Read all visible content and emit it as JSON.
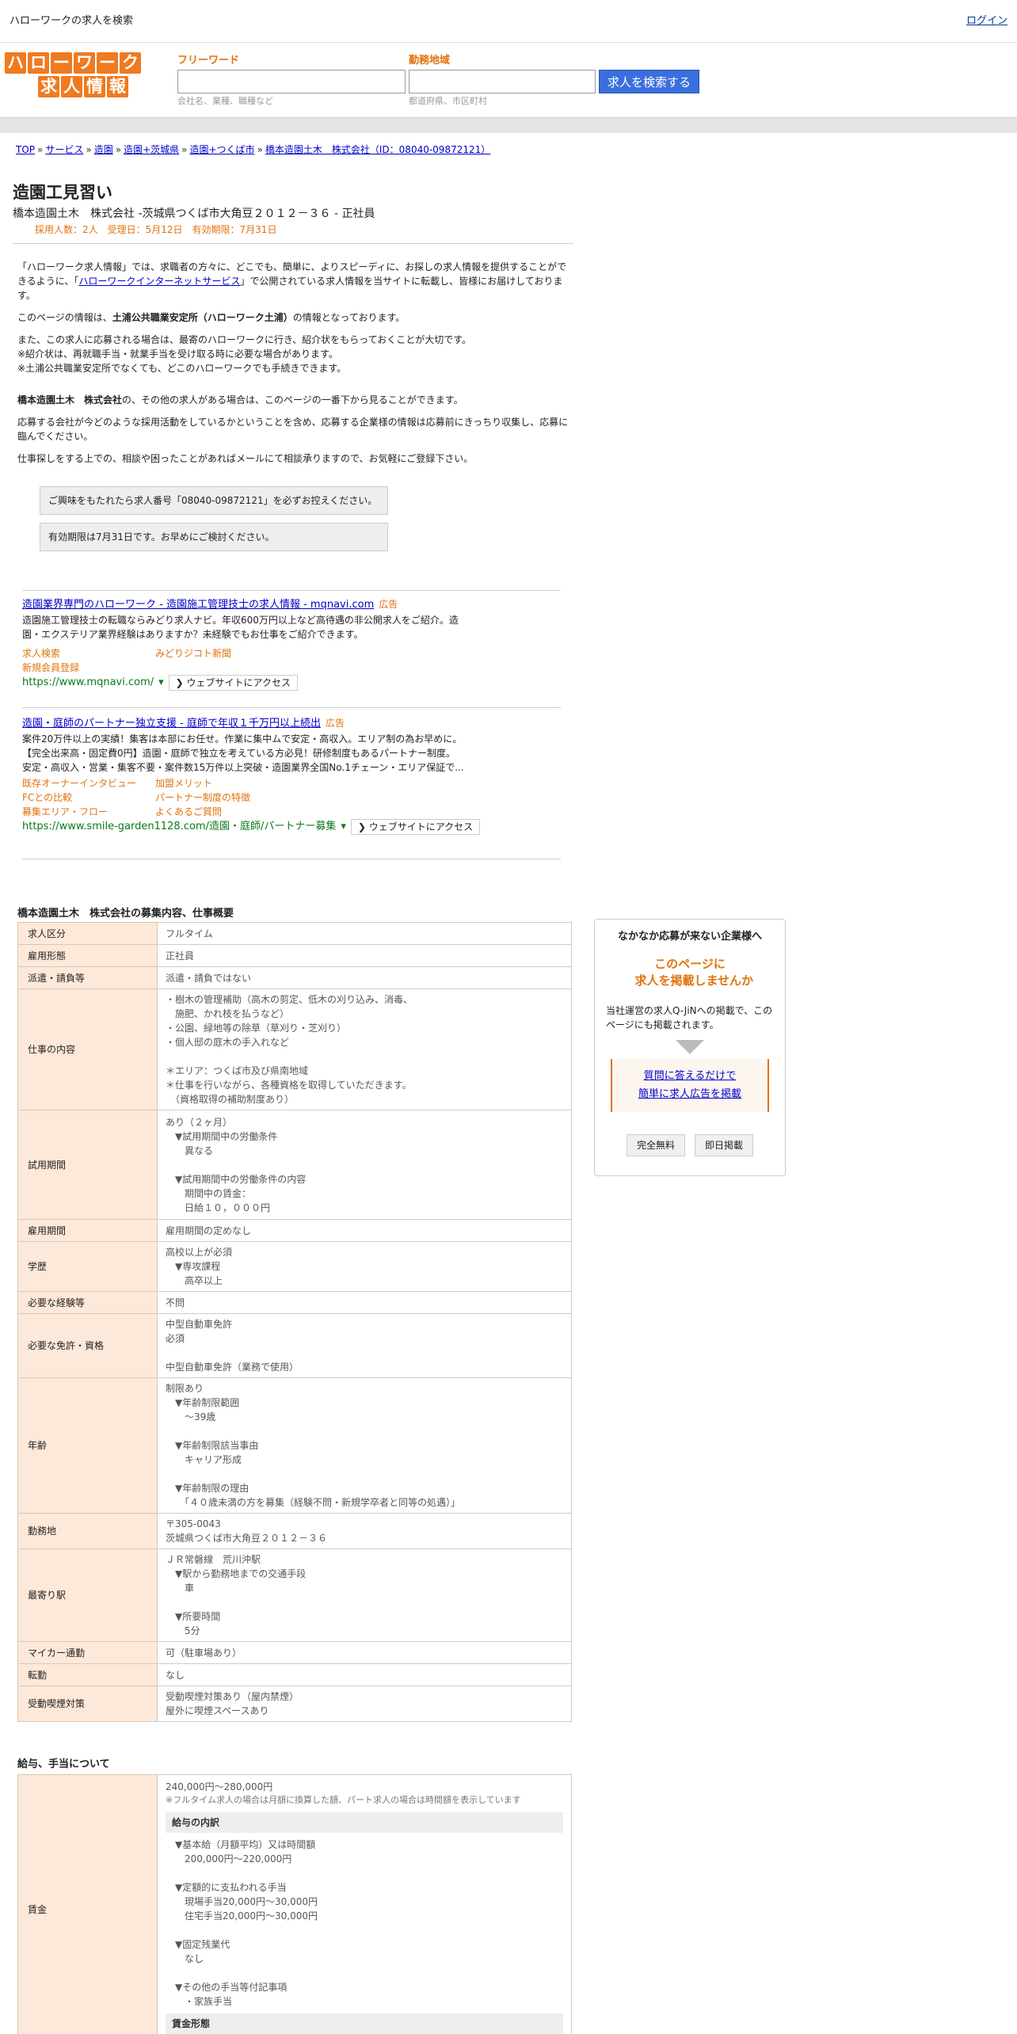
{
  "topbar": {
    "title": "ハローワークの求人を検索",
    "login": "ログイン"
  },
  "logo": {
    "row1": [
      "ハ",
      "ロ",
      "ー",
      "ワ",
      "ー",
      "ク"
    ],
    "row2": [
      "求",
      "人",
      "情",
      "報"
    ]
  },
  "search": {
    "keyword_label": "フリーワード",
    "keyword_placeholder": "会社名、業種、職種など",
    "area_label": "勤務地域",
    "area_placeholder": "都道府県、市区町村",
    "button": "求人を検索する"
  },
  "breadcrumb": [
    "TOP",
    "サービス",
    "造園",
    "造園+茨城県",
    "造園+つくば市",
    "橋本造園土木　株式会社（ID：08040-09872121）"
  ],
  "job": {
    "title": "造園工見習い",
    "subtitle": "橋本造園土木　株式会社 -茨城県つくば市大角豆２０１２－３６ - 正社員",
    "meta": "採用人数：2人　受理日：5月12日　有効期限：7月31日"
  },
  "intro": {
    "p1a": "「ハローワーク求人情報」では、求職者の方々に、どこでも、簡単に、よりスピーディに、お探しの求人情報を提供することができるように、「",
    "p1link": "ハローワークインターネットサービス",
    "p1b": "」で公開されている求人情報を当サイトに転載し、皆様にお届けしております。",
    "p2a": "このページの情報は、",
    "p2b": "土浦公共職業安定所（ハローワーク土浦）",
    "p2c": "の情報となっております。",
    "p3": "また、この求人に応募される場合は、最寄のハローワークに行き、紹介状をもらっておくことが大切です。",
    "p3b": "※紹介状は、再就職手当・就業手当を受け取る時に必要な場合があります。",
    "p3c": "※土浦公共職業安定所でなくても、どこのハローワークでも手続きできます。",
    "p4a": "橋本造園土木　株式会社",
    "p4b": "の、その他の求人がある場合は、このページの一番下から見ることができます。",
    "p5": "応募する会社が今どのような採用活動をしているかということを含め、応募する企業様の情報は応募前にきっちり収集し、応募に臨んでください。",
    "p6": "仕事探しをする上での、相談や困ったことがあればメールにて相談承りますので、お気軽にご登録下さい。",
    "note1": "ご興味をもたれたら求人番号「08040-09872121」を必ずお控えください。",
    "note2": "有効期限は7月31日です。お早めにご検討ください。"
  },
  "ad1": {
    "title": "造園業界専門のハローワーク - 造園施工管理技士の求人情報 - mqnavi.com",
    "tag": "広告",
    "desc1": "造園施工管理技士の転職ならみどり求人ナビ。年収600万円以上など高待遇の非公開求人をご紹介。造",
    "desc2": "園・エクステリア業界経験はありますか？未経験でもお仕事をご紹介できます。",
    "links": [
      "求人検索",
      "みどりジコト新聞",
      "新規会員登録"
    ],
    "url": "https://www.mqnavi.com/",
    "visit": "ウェブサイトにアクセス"
  },
  "ad2": {
    "title": "造園・庭師のパートナー独立支援 - 庭師で年収１千万円以上続出",
    "tag": "広告",
    "desc1": "案件20万件以上の実績！集客は本部にお任せ。作業に集中ムで安定・高収入。エリア制の為お早めに。",
    "desc2": "【完全出来高・固定費0円】造園・庭師で独立を考えている方必見！研修制度もあるパートナー制度。",
    "desc3": "安定・高収入・営業・集客不要・案件数15万件以上突破・造園業界全国No.1チェーン・エリア保証で...",
    "links": [
      "既存オーナーインタビュー",
      "加盟メリット",
      "FCとの比較",
      "パートナー制度の特徴",
      "募集エリア・フロー",
      "よくあるご質問"
    ],
    "url": "https://www.smile-garden1128.com/造園・庭師/パートナー募集",
    "visit": "ウェブサイトにアクセス"
  },
  "spec_title": "橋本造園土木　株式会社の募集内容、仕事概要",
  "spec": [
    {
      "k": "求人区分",
      "v": "フルタイム"
    },
    {
      "k": "雇用形態",
      "v": "正社員"
    },
    {
      "k": "派遣・請負等",
      "v": "派遣・請負ではない"
    },
    {
      "k": "仕事の内容",
      "v": "・樹木の管理補助（高木の剪定、低木の刈り込み、消毒、\n　施肥、かれ枝を払うなど）\n・公園、緑地等の除草（草刈り・芝刈り）\n・個人邸の庭木の手入れなど\n\n＊エリア：つくば市及び県南地域\n＊仕事を行いながら、各種資格を取得していただきます。\n　（資格取得の補助制度あり）"
    },
    {
      "k": "試用期間",
      "v": "あり（２ヶ月）\n　▼試用期間中の労働条件\n　　異なる\n\n　▼試用期間中の労働条件の内容\n　　期間中の賃金：\n　　日給１０，０００円"
    },
    {
      "k": "雇用期間",
      "v": "雇用期間の定めなし"
    },
    {
      "k": "学歴",
      "v": "高校以上が必須\n　▼専攻課程\n　　高卒以上"
    },
    {
      "k": "必要な経験等",
      "v": "不問"
    },
    {
      "k": "必要な免許・資格",
      "v": "中型自動車免許\n必須\n\n中型自動車免許（業務で使用）"
    },
    {
      "k": "年齢",
      "v": "制限あり\n　▼年齢制限範囲\n　　〜39歳\n\n　▼年齢制限該当事由\n　　キャリア形成\n\n　▼年齢制限の理由\n　　「４０歳未満の方を募集（経験不問・新規学卒者と同等の処遇）」"
    },
    {
      "k": "勤務地",
      "v": "〒305-0043\n茨城県つくば市大角豆２０１２－３６"
    },
    {
      "k": "最寄り駅",
      "v": "ＪＲ常磐線　荒川沖駅\n　▼駅から勤務地までの交通手段\n　　車\n\n　▼所要時間\n　　5分"
    },
    {
      "k": "マイカー通勤",
      "v": "可（駐車場あり）"
    },
    {
      "k": "転勤",
      "v": "なし"
    },
    {
      "k": "受動喫煙対策",
      "v": "受動喫煙対策あり（屋内禁煙）\n屋外に喫煙スペースあり"
    }
  ],
  "salary_title": "給与、手当について",
  "salary": {
    "k": "賃金",
    "range": "240,000円〜280,000円",
    "note": "※フルタイム求人の場合は月額に換算した額、パート求人の場合は時間額を表示しています",
    "head1": "給与の内訳",
    "detail": "　▼基本給（月額平均）又は時間額\n　　200,000円〜220,000円\n\n　▼定額的に支払われる手当\n　　現場手当20,000円〜30,000円\n　　住宅手当20,000円〜30,000円\n\n　▼固定残業代\n　　なし\n\n　▼その他の手当等付記事項\n　　・家族手当",
    "head2": "賃金形態"
  },
  "side": {
    "head": "なかなか応募が来ない企業様へ",
    "big1": "このページに",
    "big2": "求人を掲載しませんか",
    "desc": "当社運営の求人Q-JiNへの掲載で、このページにも掲載されます。",
    "q1": "質問に答えるだけで",
    "q2": "簡単に求人広告を掲載",
    "b1": "完全無料",
    "b2": "即日掲載"
  }
}
